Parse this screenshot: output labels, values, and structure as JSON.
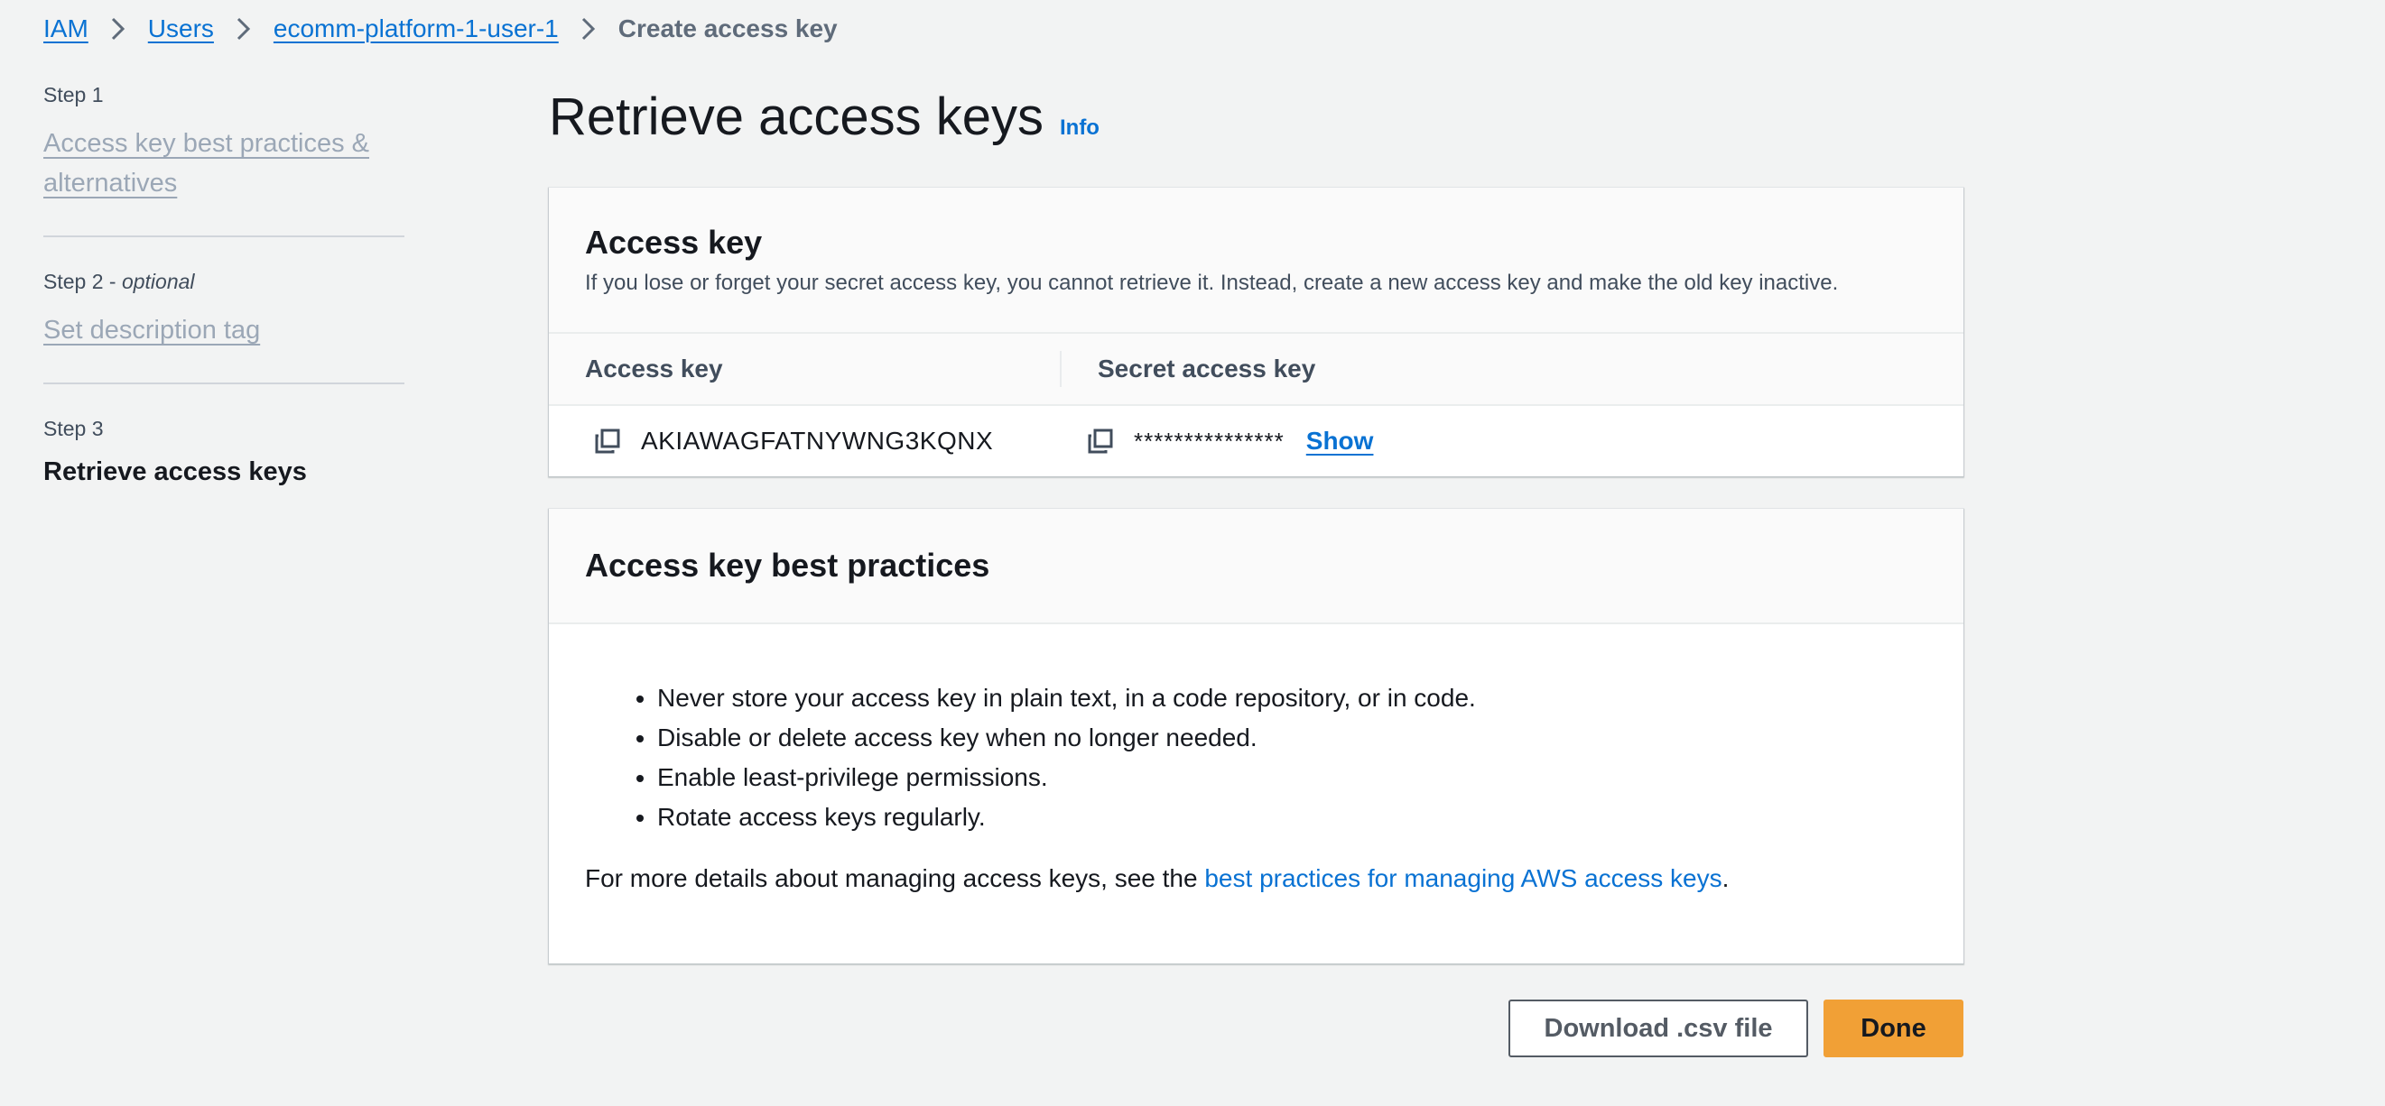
{
  "breadcrumb": {
    "items": [
      "IAM",
      "Users",
      "ecomm-platform-1-user-1"
    ],
    "current": "Create access key"
  },
  "steps": [
    {
      "label": "Step 1",
      "title": "Access key best practices & alternatives"
    },
    {
      "label": "Step 2",
      "optional": "optional",
      "title": "Set description tag"
    },
    {
      "label": "Step 3",
      "title": "Retrieve access keys"
    }
  ],
  "page": {
    "title": "Retrieve access keys",
    "info": "Info"
  },
  "access_key_panel": {
    "title": "Access key",
    "description": "If you lose or forget your secret access key, you cannot retrieve it. Instead, create a new access key and make the old key inactive.",
    "col_access_key": "Access key",
    "col_secret": "Secret access key",
    "access_key_value": "AKIAWAGFATNYWNG3KQNX",
    "secret_masked": "***************",
    "show_label": "Show"
  },
  "best_practices_panel": {
    "title": "Access key best practices",
    "items": [
      "Never store your access key in plain text, in a code repository, or in code.",
      "Disable or delete access key when no longer needed.",
      "Enable least-privilege permissions.",
      "Rotate access keys regularly."
    ],
    "more_prefix": "For more details about managing access keys, see the ",
    "more_link": "best practices for managing AWS access keys",
    "more_suffix": "."
  },
  "footer": {
    "download_label": "Download .csv file",
    "done_label": "Done"
  },
  "colors": {
    "link": "#0972d3",
    "primary_button": "#f1a036",
    "background": "#f2f3f3"
  }
}
